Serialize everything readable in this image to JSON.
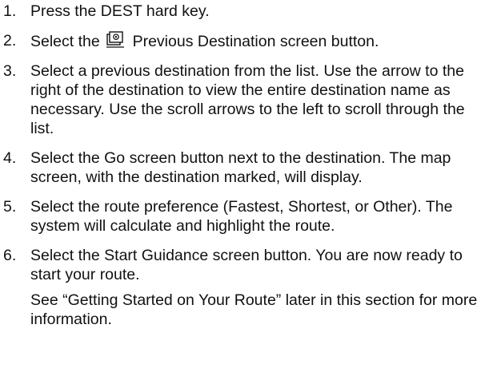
{
  "steps": [
    {
      "number": "1.",
      "text": "Press the DEST hard key."
    },
    {
      "number": "2.",
      "text_before_icon": "Select the",
      "icon": "previous-destination-icon",
      "text_after_icon": "Previous Destination screen button."
    },
    {
      "number": "3.",
      "text": "Select a previous destination from the list. Use the arrow to the right of the destination to view the entire destination name as necessary. Use the scroll arrows to the left to scroll through the list."
    },
    {
      "number": "4.",
      "text": "Select the Go screen button next to the destination. The map screen, with the destination marked, will display."
    },
    {
      "number": "5.",
      "text": "Select the route preference (Fastest, Shortest, or Other). The system will calculate and highlight the route."
    },
    {
      "number": "6.",
      "text": "Select the Start Guidance screen button. You are now ready to start your route."
    }
  ],
  "note": "See “Getting Started on Your Route” later in this section for more information."
}
